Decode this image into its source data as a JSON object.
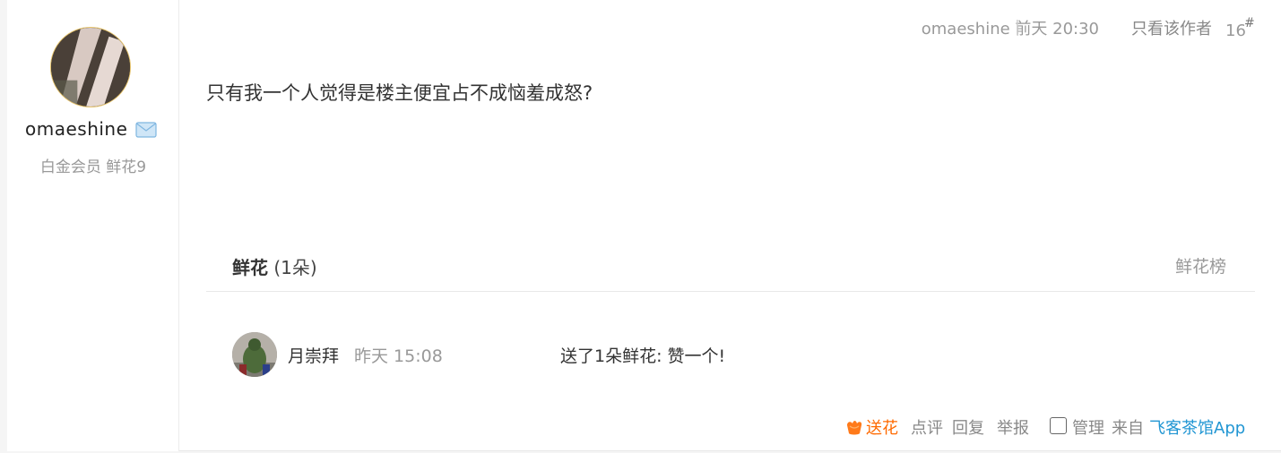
{
  "author": {
    "name": "omaeshine",
    "meta": "白金会员 鲜花9"
  },
  "post": {
    "meta": "omaeshine 前天 20:30",
    "separator": "|",
    "only_author": "只看该作者",
    "floor": "16",
    "floor_mark": "#",
    "body": "只有我一个人觉得是楼主便宜占不成恼羞成怒?"
  },
  "flowers": {
    "title": "鲜花",
    "count": "(1朵)",
    "rank_link": "鲜花榜",
    "items": [
      {
        "name": "月崇拜",
        "time": "昨天 15:08",
        "text": "送了1朵鲜花:  赞一个!"
      }
    ]
  },
  "actions": {
    "send_flower": "送花",
    "comment": "点评",
    "reply": "回复",
    "report": "举报",
    "manage": "管理",
    "from": "来自",
    "app": "飞客茶馆App"
  },
  "colors": {
    "accent_orange": "#ff6a00",
    "link_blue": "#2196d3",
    "avatar_ring": "#e6c36a"
  }
}
